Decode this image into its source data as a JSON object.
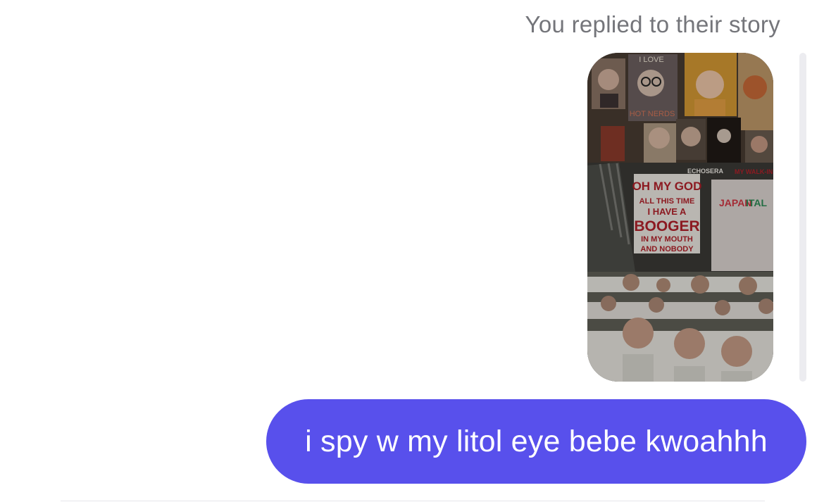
{
  "thread": {
    "story_reply_label": "You replied to their story",
    "story_thumbnail": {
      "texts": [
        "I LOVE",
        "HOT NERDS",
        "OH MY GOD",
        "ALL THIS TIME",
        "I HAVE A",
        "BOOGER",
        "IN MY MOUTH",
        "AND NOBODY",
        "JAPAN",
        "ITAL",
        "MY WALK-IN",
        "ECHOSERA"
      ],
      "icon": "story-image"
    },
    "message": {
      "text": "i spy w my litol eye bebe kwoahhh",
      "direction": "outgoing"
    }
  },
  "colors": {
    "accent": "#5850ec",
    "label": "#74757a",
    "background": "#ffffff"
  }
}
